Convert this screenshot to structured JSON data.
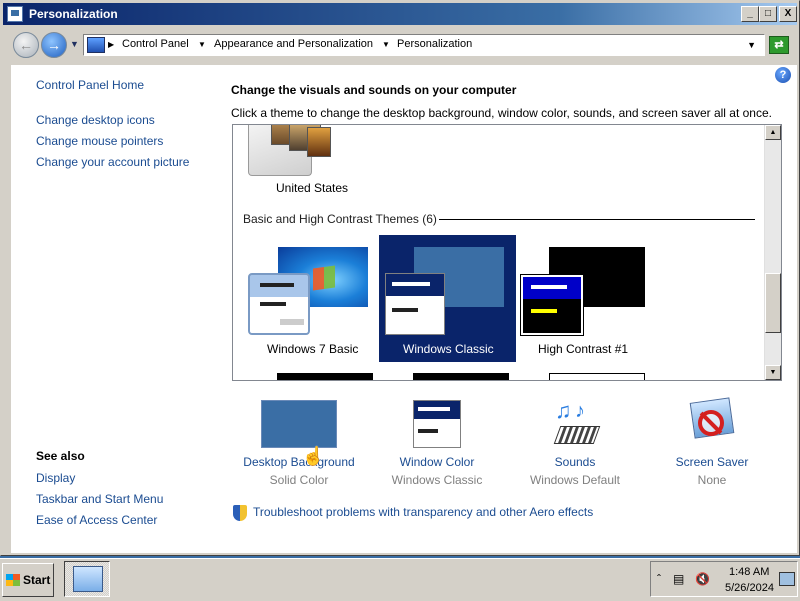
{
  "window": {
    "title": "Personalization"
  },
  "title_buttons": {
    "minimize": "_",
    "maximize": "□",
    "close": "X"
  },
  "address_bar": {
    "breadcrumbs": [
      "Control Panel",
      "Appearance and Personalization",
      "Personalization"
    ],
    "go_icon": "refresh-arrows-icon"
  },
  "sidebar": {
    "links": [
      "Control Panel Home",
      "Change desktop icons",
      "Change mouse pointers",
      "Change your account picture"
    ],
    "see_also_title": "See also",
    "see_also_links": [
      "Display",
      "Taskbar and Start Menu",
      "Ease of Access Center"
    ]
  },
  "main": {
    "heading": "Change the visuals and sounds on your computer",
    "subheading": "Click a theme to change the desktop background, window color, sounds, and screen saver all at once.",
    "themes_above": [
      {
        "label": "United States"
      }
    ],
    "group_title": "Basic and High Contrast Themes (6)",
    "themes": [
      {
        "label": "Windows 7 Basic",
        "selected": false
      },
      {
        "label": "Windows Classic",
        "selected": true
      },
      {
        "label": "High Contrast #1",
        "selected": false
      }
    ]
  },
  "settings": [
    {
      "title": "Desktop Background",
      "subtitle": "Solid Color",
      "icon": "solid-color-swatch-icon",
      "color": "#3a6ea5"
    },
    {
      "title": "Window Color",
      "subtitle": "Windows Classic",
      "icon": "window-color-icon"
    },
    {
      "title": "Sounds",
      "subtitle": "Windows Default",
      "icon": "music-notes-icon"
    },
    {
      "title": "Screen Saver",
      "subtitle": "None",
      "icon": "screen-saver-none-icon"
    }
  ],
  "troubleshoot_link": "Troubleshoot problems with transparency and other Aero effects",
  "taskbar": {
    "start_label": "Start",
    "clock_time": "1:48 AM",
    "clock_date": "5/26/2024"
  },
  "colors": {
    "selection": "#0a246a",
    "link": "#1b4c91",
    "desktop": "#3a6ea5"
  }
}
